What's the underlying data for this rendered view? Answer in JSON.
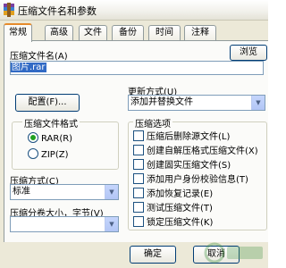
{
  "window": {
    "title": "压缩文件名和参数"
  },
  "tabs": [
    "常规",
    "高级",
    "文件",
    "备份",
    "时间",
    "注释"
  ],
  "archive_name": {
    "label": "压缩文件名(A)",
    "value": "图片.rar",
    "browse_label": "浏览(B)..."
  },
  "update_mode": {
    "label": "更新方式(U)",
    "value": "添加并替换文件"
  },
  "profiles_button": "配置(F)...",
  "format": {
    "label": "压缩文件格式",
    "options": [
      "RAR(R)",
      "ZIP(Z)"
    ],
    "selected": "RAR(R)"
  },
  "method": {
    "label": "压缩方式(C)",
    "value": "标准"
  },
  "volume": {
    "label": "压缩分卷大小，字节(V)",
    "value": ""
  },
  "options": {
    "label": "压缩选项",
    "items": [
      "压缩后删除源文件(L)",
      "创建自解压格式压缩文件(X)",
      "创建固实压缩文件(S)",
      "添加用户身份校验信息(T)",
      "添加恢复记录(E)",
      "测试压缩文件(T)",
      "锁定压缩文件(K)"
    ]
  },
  "buttons": {
    "ok": "确定",
    "cancel": "取消"
  },
  "colors": {
    "tab_accent": "#e68b2c",
    "dialog_bg": "#ece9d8",
    "selection": "#316ac5"
  }
}
